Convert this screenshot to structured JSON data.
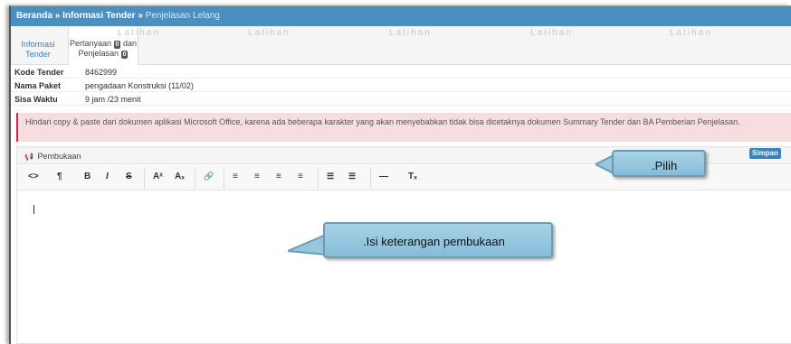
{
  "breadcrumb": {
    "home": "Beranda",
    "sep1": "»",
    "section": "Informasi Tender",
    "sep2": "»",
    "current": "Penjelasan Lelang"
  },
  "tabs": [
    {
      "line1": "Informasi",
      "line2": "Tender"
    },
    {
      "line1": "Pertanyaan",
      "badge1": "0",
      "mid": "dan",
      "line2": "Penjelasan",
      "badge2": "0"
    }
  ],
  "watermark": "Latihan",
  "info": [
    {
      "label": "Kode Tender",
      "value": "8462999"
    },
    {
      "label": "Nama Paket",
      "value": "pengadaan Konstruksi (11/02)"
    },
    {
      "label": "Sisa Waktu",
      "value": "9 jam /23 menit"
    }
  ],
  "alert": "Hindari copy & paste dari dokumen aplikasi Microsoft Office, karena ada beberapa karakter yang akan menyebabkan tidak bisa dicetaknya dokumen Summary Tender dan BA Pemberian Penjelasan.",
  "section": {
    "icon": "megaphone-icon",
    "title": "Pembukaan",
    "save_label": "Simpan"
  },
  "toolbar": [
    {
      "name": "code-view-icon",
      "glyph": "<>"
    },
    {
      "name": "paragraph-icon",
      "glyph": "¶"
    },
    {
      "name": "bold-icon",
      "glyph": "B"
    },
    {
      "name": "italic-icon",
      "glyph": "I"
    },
    {
      "name": "strikethrough-icon",
      "glyph": "S"
    },
    {
      "name": "superscript-icon",
      "glyph": "Aˣ"
    },
    {
      "name": "subscript-icon",
      "glyph": "Aₓ"
    },
    {
      "name": "link-icon",
      "glyph": "🔗"
    },
    {
      "name": "align-left-icon",
      "glyph": "≡"
    },
    {
      "name": "align-center-icon",
      "glyph": "≡"
    },
    {
      "name": "align-right-icon",
      "glyph": "≡"
    },
    {
      "name": "align-justify-icon",
      "glyph": "≡"
    },
    {
      "name": "bullet-list-icon",
      "glyph": "☰"
    },
    {
      "name": "number-list-icon",
      "glyph": "☰"
    },
    {
      "name": "horizontal-rule-icon",
      "glyph": "—"
    },
    {
      "name": "clear-format-icon",
      "glyph": "Tₓ"
    }
  ],
  "callouts": {
    "pilih": ".Pilih",
    "isi": ".Isi keterangan pembukaan"
  }
}
